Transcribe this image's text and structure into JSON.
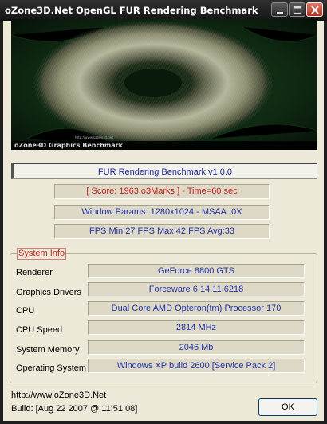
{
  "window": {
    "title": "oZone3D.Net OpenGL FUR Rendering Benchmark",
    "buttons": {
      "minimize_icon": "minimize-icon",
      "maximize_icon": "maximize-icon",
      "close_icon": "close-icon"
    }
  },
  "banner": {
    "brand": "oZone3D Graphics Benchmark",
    "url": "http://www.ozone3d.net"
  },
  "bench_title": "FUR Rendering Benchmark v1.0.0",
  "score": "[ Score: 1963 o3Marks ] - Time=60 sec",
  "window_params": "Window Params: 1280x1024 - MSAA: 0X",
  "fps": "FPS Min:27   FPS Max:42   FPS Avg:33",
  "system_info": {
    "label": "System Info",
    "rows": [
      {
        "label": "Renderer",
        "value": "GeForce 8800 GTS"
      },
      {
        "label": "Graphics Drivers",
        "value": "Forceware 6.14.11.6218"
      },
      {
        "label": "CPU",
        "value": "Dual Core AMD Opteron(tm) Processor 170"
      },
      {
        "label": "CPU Speed",
        "value": "2814 MHz"
      },
      {
        "label": "System Memory",
        "value": "2046 Mb"
      },
      {
        "label": "Operating System",
        "value": "Windows XP build 2600 [Service Pack 2]"
      }
    ]
  },
  "footer": {
    "url": "http://www.oZone3D.Net",
    "build": "Build: [Aug 22 2007 @ 11:51:08]",
    "ok_label": "OK"
  },
  "colors": {
    "title_text": "#ffffff",
    "score_red": "#c62020",
    "info_blue": "#2233a8",
    "face": "#ece9d8"
  }
}
